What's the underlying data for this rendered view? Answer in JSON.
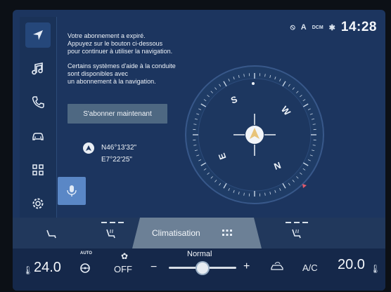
{
  "status": {
    "time": "14:28",
    "indicator_a": "A",
    "indicator_dcm": "DCM"
  },
  "sidebar": {
    "items": [
      {
        "id": "navigation",
        "icon": "navigation-arrow-icon",
        "active": true
      },
      {
        "id": "music",
        "icon": "music-note-icon"
      },
      {
        "id": "phone",
        "icon": "phone-icon"
      },
      {
        "id": "car",
        "icon": "car-icon"
      },
      {
        "id": "apps",
        "icon": "apps-grid-icon"
      },
      {
        "id": "settings",
        "icon": "gear-icon"
      }
    ]
  },
  "message": {
    "line1": "Votre abonnement a expiré.",
    "line2": "Appuyez sur le bouton ci-dessous",
    "line3": "pour continuer à utiliser la navigation.",
    "line4": "Certains systèmes d'aide à la conduite",
    "line5": "sont disponibles avec",
    "line6": "un abonnement à la navigation."
  },
  "subscribe_button": "S'abonner maintenant",
  "coordinates": {
    "lat": "N46°13'32\"",
    "lon": "E7°22'25\""
  },
  "compass": {
    "labels": [
      "S",
      "W",
      "N",
      "E"
    ]
  },
  "climate": {
    "label": "Climatisation"
  },
  "bottom": {
    "left_temp": "24.0",
    "right_temp": "20.0",
    "auto": "AUTO",
    "fan_off": "OFF",
    "fan_mode": "Normal",
    "minus": "−",
    "plus": "+",
    "ac": "A/C",
    "fan_level": 0.5
  },
  "colors": {
    "screen": "#1c355f",
    "accent_mic": "#5a87c6",
    "compass_cursor": "#e8c47a"
  }
}
